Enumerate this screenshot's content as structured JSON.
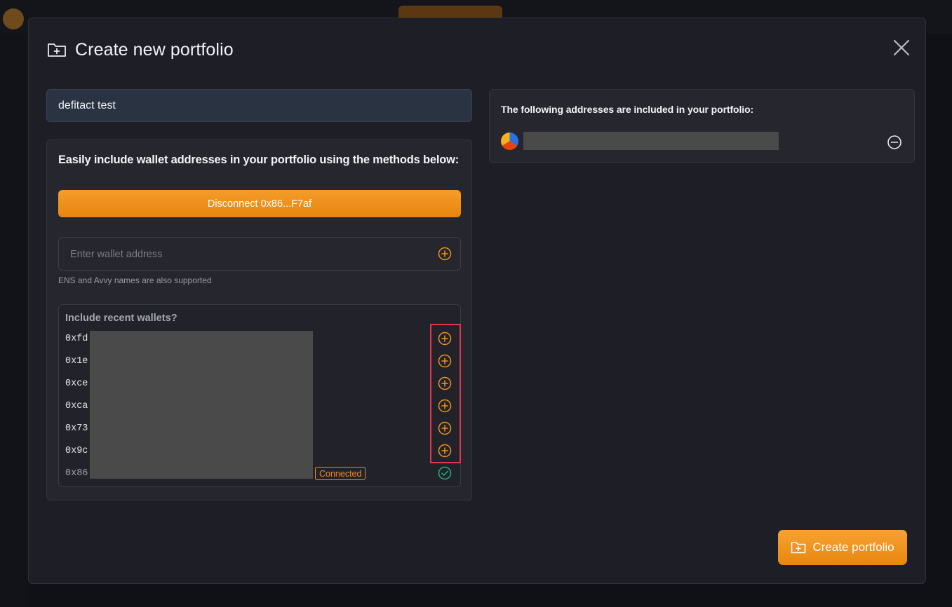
{
  "modal": {
    "title": "Create new portfolio",
    "title_icon": "folder-plus-icon",
    "close_icon": "close-icon"
  },
  "portfolio_name": {
    "value": "defitact test"
  },
  "methods": {
    "instructions": "Easily include wallet addresses in your portfolio using the methods below:",
    "disconnect_label": "Disconnect 0x86...F7af",
    "address_input": {
      "placeholder": "Enter wallet address",
      "value": "",
      "add_icon": "plus-circle-icon"
    },
    "hint": "ENS and Avvy names are also supported"
  },
  "recent_wallets": {
    "title": "Include recent wallets?",
    "items": [
      {
        "address": "0xfd",
        "action": "plus-circle-icon"
      },
      {
        "address": "0x1e",
        "action": "plus-circle-icon"
      },
      {
        "address": "0xce",
        "action": "plus-circle-icon"
      },
      {
        "address": "0xca",
        "action": "plus-circle-icon"
      },
      {
        "address": "0x73",
        "action": "plus-circle-icon"
      },
      {
        "address": "0x9c",
        "action": "plus-circle-icon"
      },
      {
        "address": "0x86",
        "action": "check-circle-icon",
        "badge": "Connected"
      }
    ]
  },
  "included": {
    "title": "The following addresses are included in your portfolio:",
    "remove_icon": "minus-circle-icon"
  },
  "create_button": {
    "label": "Create portfolio",
    "icon": "folder-plus-icon"
  },
  "colors": {
    "accent": "#f0901c",
    "highlight": "#e0384a",
    "success": "#22b07d",
    "modal_bg": "#1e1f26"
  }
}
